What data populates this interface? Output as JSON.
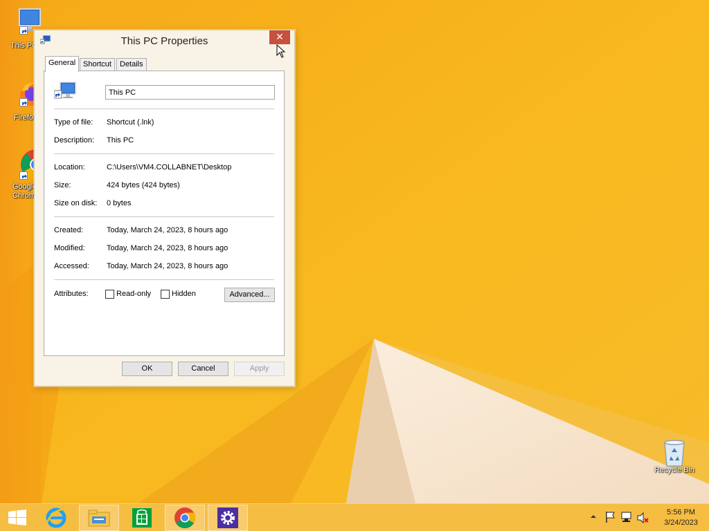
{
  "desktop": {
    "icons": [
      {
        "label": "This PC"
      },
      {
        "label": "Firefox"
      },
      {
        "label": "Google Chrome"
      },
      {
        "label": "Recycle Bin"
      }
    ]
  },
  "window": {
    "title": "This PC Properties",
    "close_symbol": "✕",
    "tabs": [
      {
        "label": "General",
        "active": true
      },
      {
        "label": "Shortcut",
        "active": false
      },
      {
        "label": "Details",
        "active": false
      }
    ],
    "name_value": "This PC",
    "type_label": "Type of file:",
    "type_value": "Shortcut (.lnk)",
    "description_label": "Description:",
    "description_value": "This PC",
    "location_label": "Location:",
    "location_value": "C:\\Users\\VM4.COLLABNET\\Desktop",
    "size_label": "Size:",
    "size_value": "424 bytes (424 bytes)",
    "size_on_disk_label": "Size on disk:",
    "size_on_disk_value": "0 bytes",
    "created_label": "Created:",
    "created_value": "Today, March 24, 2023, 8 hours ago",
    "modified_label": "Modified:",
    "modified_value": "Today, March 24, 2023, 8 hours ago",
    "accessed_label": "Accessed:",
    "accessed_value": "Today, March 24, 2023, 8 hours ago",
    "attributes_label": "Attributes:",
    "readonly_label": "Read-only",
    "readonly_checked": false,
    "hidden_label": "Hidden",
    "hidden_checked": false,
    "advanced_label": "Advanced...",
    "ok_label": "OK",
    "cancel_label": "Cancel",
    "apply_label": "Apply",
    "apply_enabled": false
  },
  "taskbar": {
    "pinned": [
      {
        "icon": "windows-start-icon"
      },
      {
        "icon": "internet-explorer-icon"
      },
      {
        "icon": "file-explorer-icon",
        "running": true
      },
      {
        "icon": "windows-store-icon"
      },
      {
        "icon": "chrome-icon",
        "running": true
      },
      {
        "icon": "settings-icon",
        "running": true
      }
    ],
    "clock_time": "5:56 PM",
    "clock_date": "3/24/2023"
  },
  "colors": {
    "wallpaper_orange": "#f7b21a",
    "close_button": "#c7503f"
  }
}
